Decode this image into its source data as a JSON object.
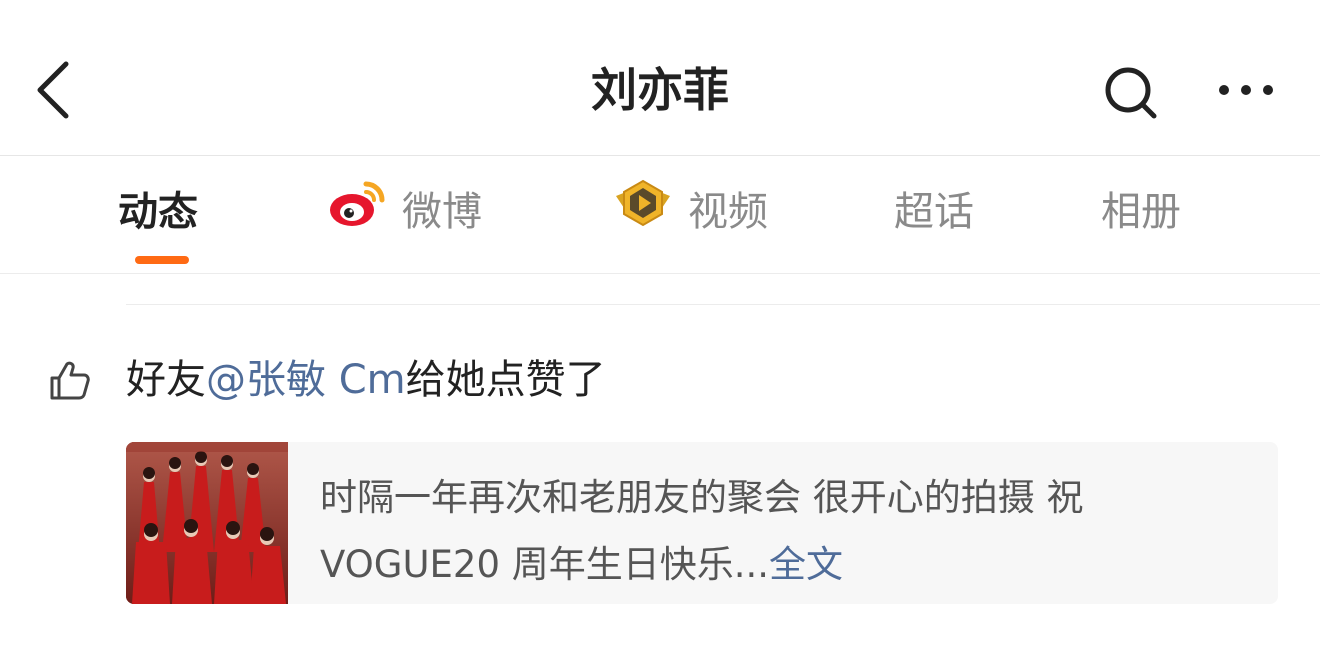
{
  "header": {
    "title": "刘亦菲"
  },
  "icons": {
    "back": "chevron-left-icon",
    "search": "search-icon",
    "more": "more-dots-icon",
    "weibo": "weibo-logo-icon",
    "video": "video-badge-icon",
    "like": "thumbs-up-icon"
  },
  "tabs": [
    {
      "label": "动态",
      "active": true
    },
    {
      "label": "微博",
      "active": false
    },
    {
      "label": "视频",
      "active": false
    },
    {
      "label": "超话",
      "active": false
    },
    {
      "label": "相册",
      "active": false
    }
  ],
  "activity": {
    "prefix": "好友",
    "mention": "@张敏 Cm",
    "suffix": "给她点赞了"
  },
  "post": {
    "text": "时隔一年再次和老朋友的聚会 很开心的拍摄 祝 VOGUE20 周年生日快乐...",
    "more_link": "全文"
  },
  "colors": {
    "accent": "#ff6a14",
    "link": "#4f6c99",
    "text_primary": "#222222",
    "text_secondary": "#8a8a8a",
    "card_bg": "#f7f7f7"
  }
}
